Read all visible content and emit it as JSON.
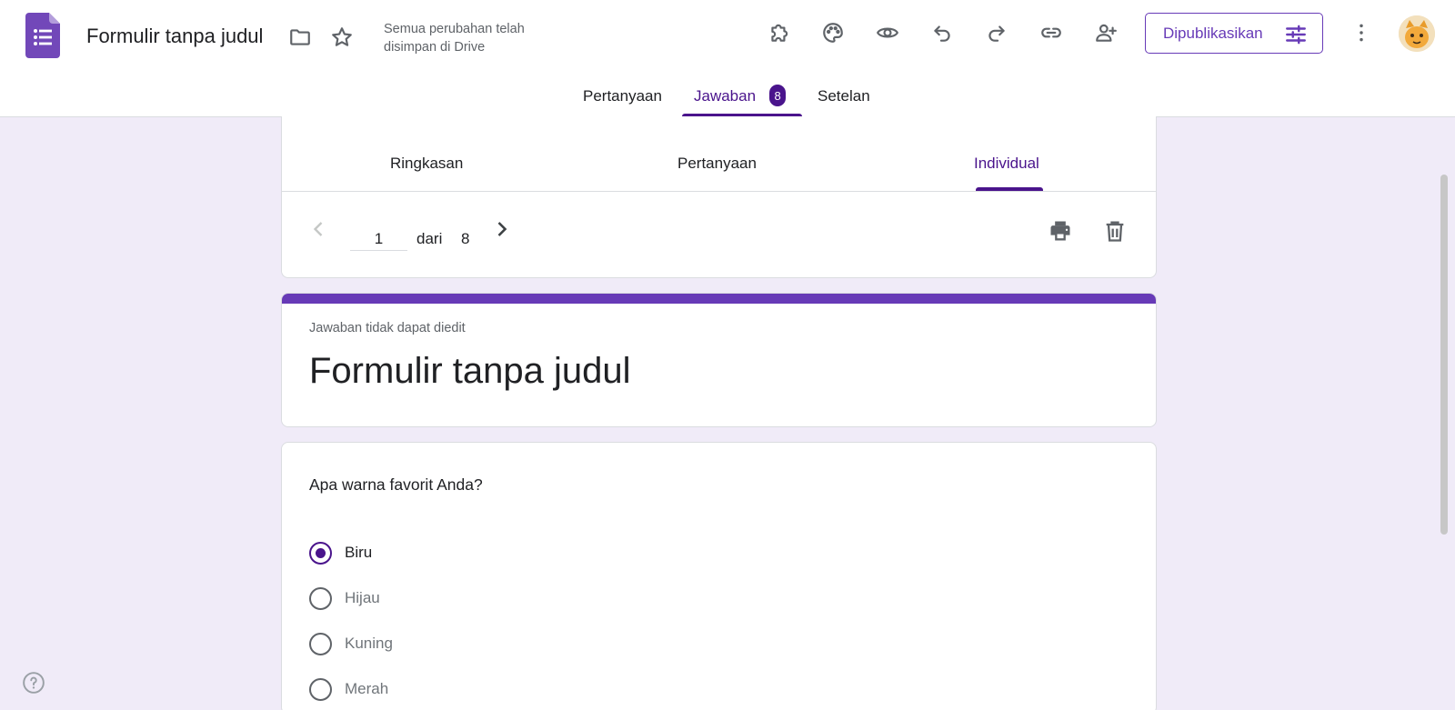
{
  "header": {
    "doc_title": "Formulir tanpa judul",
    "save_status": "Semua perubahan telah disimpan di Drive",
    "publish_label": "Dipublikasikan",
    "icons": [
      "forms-logo-icon",
      "folder-icon",
      "star-icon",
      "addon-icon",
      "palette-icon",
      "preview-eye-icon",
      "undo-icon",
      "redo-icon",
      "link-icon",
      "add-collaborator-icon",
      "more-vert-icon"
    ]
  },
  "main_tabs": {
    "questions": "Pertanyaan",
    "responses": "Jawaban",
    "responses_count": "8",
    "settings": "Setelan"
  },
  "sub_tabs": {
    "summary": "Ringkasan",
    "question": "Pertanyaan",
    "individual": "Individual"
  },
  "pager": {
    "current": "1",
    "of_label": "dari",
    "total": "8"
  },
  "form": {
    "readonly_note": "Jawaban tidak dapat diedit",
    "title": "Formulir tanpa judul"
  },
  "question": {
    "text": "Apa warna favorit Anda?",
    "options": [
      "Biru",
      "Hijau",
      "Kuning",
      "Merah"
    ],
    "selected": "Biru"
  },
  "colors": {
    "accent": "#673ab7",
    "accent_dark": "#4a148c",
    "background": "#f0ebf8"
  }
}
